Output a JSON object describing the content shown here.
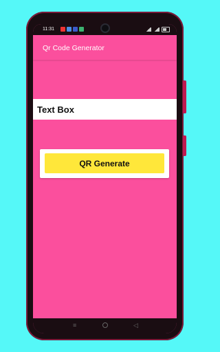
{
  "status_bar": {
    "time": "11:31"
  },
  "app_bar": {
    "title": "Qr Code Generator"
  },
  "text_box": {
    "label": "Text Box"
  },
  "button": {
    "label": "QR Generate"
  },
  "colors": {
    "background": "#55f8f8",
    "app_bg": "#fb4f9d",
    "button_bg": "#ffe73a"
  },
  "icons": [
    "menu-icon",
    "home-icon",
    "back-icon"
  ]
}
